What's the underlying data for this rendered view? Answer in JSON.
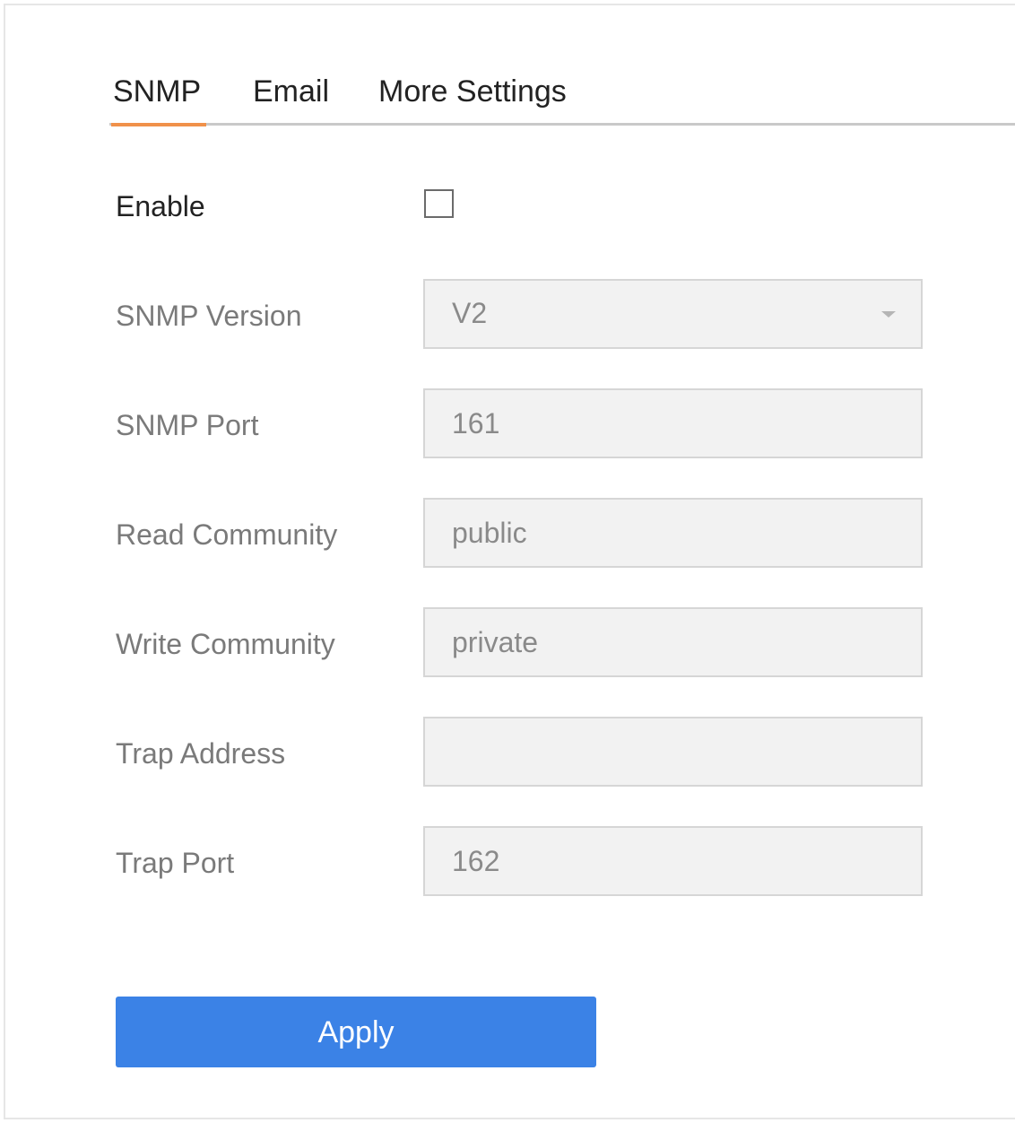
{
  "tabs": [
    {
      "label": "SNMP",
      "active": true
    },
    {
      "label": "Email",
      "active": false
    },
    {
      "label": "More Settings",
      "active": false
    }
  ],
  "form": {
    "enable": {
      "label": "Enable",
      "checked": false
    },
    "snmp_version": {
      "label": "SNMP Version",
      "value": "V2"
    },
    "snmp_port": {
      "label": "SNMP Port",
      "value": "161"
    },
    "read_community": {
      "label": "Read Community",
      "value": "public"
    },
    "write_community": {
      "label": "Write Community",
      "value": "private"
    },
    "trap_address": {
      "label": "Trap Address",
      "value": ""
    },
    "trap_port": {
      "label": "Trap Port",
      "value": "162"
    }
  },
  "actions": {
    "apply_label": "Apply"
  },
  "colors": {
    "accent_underline": "#f0914a",
    "primary_button": "#3b82e6"
  },
  "icons": {
    "dropdown": "chevron-down-icon"
  }
}
